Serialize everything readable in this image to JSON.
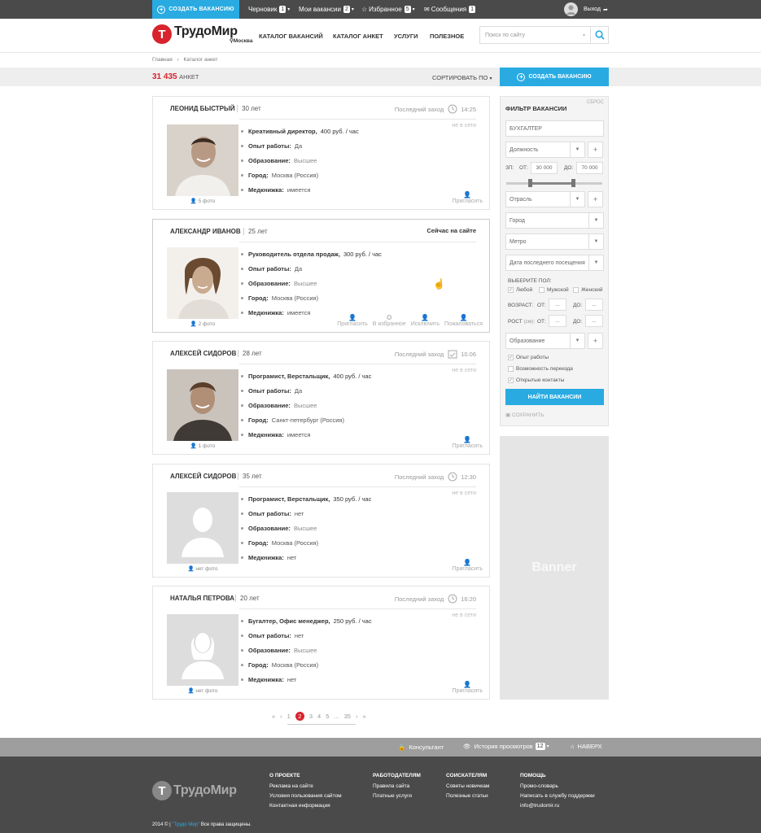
{
  "topbar": {
    "create_label": "СОЗДАТЬ ВАКАНСИЮ",
    "drafts_label": "Черновик",
    "drafts_count": "1",
    "myvac_label": "Мои вакансии",
    "myvac_count": "2",
    "fav_label": "Избранное",
    "fav_count": "5",
    "msg_label": "Сообщения",
    "msg_count": "1",
    "logout_label": "Выход"
  },
  "header": {
    "logo_letter": "Т",
    "logo_text": "ТрудоМир",
    "city": "Москва",
    "nav": [
      "КАТАЛОГ ВАКАНСИЙ",
      "КАТАЛОГ АНКЕТ",
      "УСЛУГИ",
      "ПОЛЕЗНОЕ"
    ],
    "search_placeholder": "Поиск по сайту"
  },
  "breadcrumb": {
    "home": "Главная",
    "current": "Каталог анкет"
  },
  "sortbar": {
    "count": "31 435",
    "count_unit": "АНКЕТ",
    "sort_label": "СОРТИРОВАТЬ ПО",
    "create_label": "СОЗДАТЬ ВАКАНСИЮ"
  },
  "labels": {
    "experience": "Опыт работы:",
    "education": "Образование:",
    "city": "Город:",
    "medbook": "Медкнижка:",
    "last_visit": "Последний заход",
    "offline": "не в сети",
    "invite": "Пригласить",
    "to_fav": "В избранное",
    "exclude": "Исключить",
    "report": "Пожаловаться"
  },
  "cards": [
    {
      "name": "ЛЕОНИД БЫСТРЫЙ",
      "age": "30 лет",
      "visit": "14:25",
      "position": "Креативный директор,",
      "rate": "400 руб. / час",
      "experience": "Да",
      "education": "Высшее",
      "city": "Москва (Россия)",
      "medbook": "имеется",
      "photos": "5 фото"
    },
    {
      "name": "АЛЕКСАНДР ИВАНОВ",
      "age": "25 лет",
      "online": "Сейчас на сайте",
      "position": "Руководитель отдела продаж,",
      "rate": "300 руб. / час",
      "experience": "Да",
      "education": "Высшее",
      "city": "Москва (Россия)",
      "medbook": "имеется",
      "photos": "2 фото"
    },
    {
      "name": "АЛЕКСЕЙ СИДОРОВ",
      "age": "28 лет",
      "visit": "10.06",
      "position": "Програмист, Верстальщик,",
      "rate": "400 руб. / час",
      "experience": "Да",
      "education": "Высшее",
      "city": "Санкт-петербург (Россия)",
      "medbook": "имеется",
      "photos": "1 фото"
    },
    {
      "name": "АЛЕКСЕЙ СИДОРОВ",
      "age": "35 лет",
      "visit": "12:30",
      "position": "Програмист, Верстальщик,",
      "rate": "350 руб. / час",
      "experience": "нет",
      "education": "Высшее",
      "city": "Москва (Россия)",
      "medbook": "нет",
      "photos": "нет фото"
    },
    {
      "name": "НАТАЛЬЯ ПЕТРОВА",
      "age": "20 лет",
      "visit": "16:20",
      "position": "Бугалтер, Офис менеджер,",
      "rate": "250 руб. / час",
      "experience": "нет",
      "education": "Высшее",
      "city": "Москва (Россия)",
      "medbook": "нет",
      "photos": "нет фото"
    }
  ],
  "filter": {
    "title": "ФИЛЬТР ВАКАНСИИ",
    "reset": "СБРОС",
    "keyword": "БУХГАЛТЕР",
    "position": "Должность",
    "salary_label": "ЗП:",
    "from_label": "ОТ:",
    "salary_from": "30 000",
    "to_label": "ДО:",
    "salary_to": "70 000",
    "industry": "Отрасль",
    "city": "Город",
    "metro": "Метро",
    "last_visit": "Дата последнего посещения",
    "gender_label": "ВЫБЕРИТЕ ПОЛ:",
    "gender_any": "Любой",
    "gender_male": "Мужской",
    "gender_female": "Женский",
    "age_label": "ВОЗРАСТ:",
    "height_label": "РОСТ",
    "height_unit": "(см):",
    "empty_val": "...",
    "education": "Образование",
    "exp_label": "Опыт работы",
    "relocation_label": "Возможность переезда",
    "contacts_label": "Открытые контакты",
    "find_label": "НАЙТИ ВАКАНСИИ",
    "save_label": "СОХРАНИТЬ"
  },
  "banner": "Banner",
  "pagination": {
    "pages": [
      "1",
      "2",
      "3",
      "4",
      "5",
      "...",
      "35"
    ],
    "current": "2"
  },
  "footbar": {
    "consultant": "Консультант",
    "history": "История просмотров",
    "history_count": "12",
    "top": "НАВЕРХ"
  },
  "footer": {
    "logo_text": "ТрудоМир",
    "col1": {
      "title": "О ПРОЕКТЕ",
      "items": [
        "Реклама на сайте",
        "Условия пользования сайтом",
        "Контактная информация"
      ]
    },
    "col2": {
      "title": "РАБОТОДАТЕЛЯМ",
      "items": [
        "Правила сайта",
        "Платные услуги"
      ]
    },
    "col3": {
      "title": "СОИСКАТЕЛЯМ",
      "items": [
        "Советы новичкам",
        "Полезные статьи"
      ]
    },
    "col4": {
      "title": "ПОМОЩЬ",
      "items": [
        "Промо-словарь",
        "Написать в службу поддержки",
        "info@trudomir.ru"
      ]
    },
    "copy_prefix": "2014 © |",
    "copy_brand": "\"Трудо Мир\"",
    "copy_suffix": "Все права защищены."
  },
  "colors": {
    "accent": "#29abe2",
    "brand_red": "#d9232d",
    "dark": "#4a4a4a"
  }
}
